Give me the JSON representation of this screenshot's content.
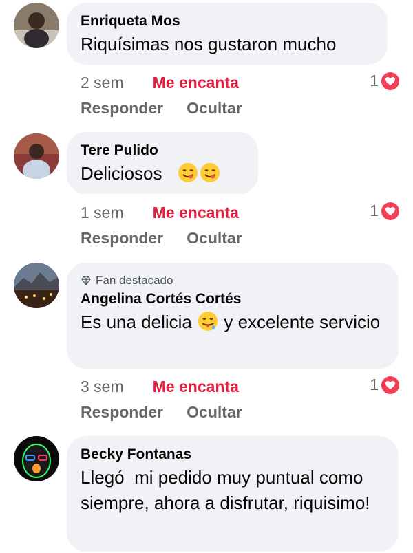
{
  "comments": [
    {
      "author": "Enriqueta Mos",
      "text": "Riquísimas nos gustaron mucho",
      "time": "2 sem",
      "reaction_label": "Me encanta",
      "reply_label": "Responder",
      "hide_label": "Ocultar",
      "reaction_count": "1"
    },
    {
      "author": "Tere Pulido",
      "text": "Deliciosos",
      "time": "1 sem",
      "reaction_label": "Me encanta",
      "reply_label": "Responder",
      "hide_label": "Ocultar",
      "reaction_count": "1"
    },
    {
      "badge": "Fan destacado",
      "author": "Angelina Cortés Cortés",
      "text_part1": "Es una delicia",
      "text_part2": "y excelente servicio",
      "time": "3 sem",
      "reaction_label": "Me encanta",
      "reply_label": "Responder",
      "hide_label": "Ocultar",
      "reaction_count": "1"
    },
    {
      "author": "Becky Fontanas",
      "text": "Llegó  mi pedido muy puntual como siempre, ahora a disfrutar, riquisimo!"
    }
  ],
  "colors": {
    "bubble": "#f0f2f5",
    "love": "#e41e3f",
    "meta": "#65676b"
  }
}
